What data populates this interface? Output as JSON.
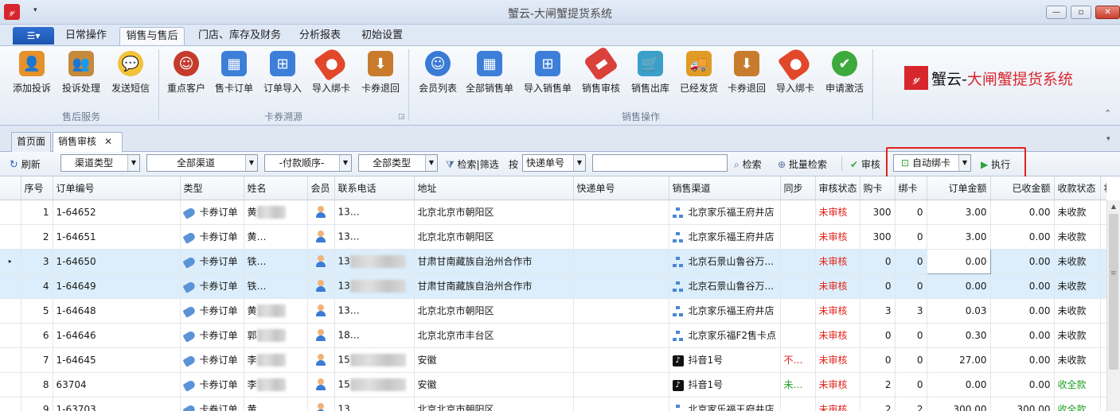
{
  "app": {
    "title": "蟹云-大闸蟹提货系统",
    "qa_arrow": "▾",
    "icon_text": "𝓎"
  },
  "window_controls": {
    "minimize": "—",
    "maximize": "▫",
    "close": "✕"
  },
  "menu": {
    "file_label": "☰▾",
    "tabs": [
      {
        "label": "日常操作",
        "active": false
      },
      {
        "label": "销售与售后",
        "active": true
      },
      {
        "label": "门店、库存及财务",
        "active": false
      },
      {
        "label": "分析报表",
        "active": false
      },
      {
        "label": "初始设置",
        "active": false
      }
    ]
  },
  "ribbon": {
    "groups": [
      {
        "label": "售后服务",
        "buttons": [
          {
            "label": "添加投诉",
            "icon": "add-complaint-icon",
            "color": "#e6912c"
          },
          {
            "label": "投诉处理",
            "icon": "handle-complaint-icon",
            "color": "#c58a3b"
          },
          {
            "label": "发送短信",
            "icon": "sms-bubble-icon",
            "color": "#f2c23a"
          }
        ]
      },
      {
        "label": "卡券溯源",
        "buttons": [
          {
            "label": "重点客户",
            "icon": "key-customer-icon",
            "color": "#c43b2c"
          },
          {
            "label": "售卡订单",
            "icon": "card-order-grid-icon",
            "color": "#3d7fd8"
          },
          {
            "label": "订单导入",
            "icon": "order-import-tree-icon",
            "color": "#3d7fd8"
          },
          {
            "label": "导入绑卡",
            "icon": "import-bind-tag-icon",
            "color": "#e2472a"
          },
          {
            "label": "卡券退回",
            "icon": "card-return-box-icon",
            "color": "#c97b2d"
          }
        ]
      },
      {
        "label": "销售操作",
        "buttons": [
          {
            "label": "会员列表",
            "icon": "member-list-icon",
            "color": "#3a7bd5"
          },
          {
            "label": "全部销售单",
            "icon": "all-sales-grid-icon",
            "color": "#3d7fd8"
          },
          {
            "label": "导入销售单",
            "icon": "import-sales-tree-icon",
            "color": "#3d7fd8"
          },
          {
            "label": "销售审核",
            "icon": "sales-audit-eraser-icon",
            "color": "#d9413a"
          },
          {
            "label": "销售出库",
            "icon": "sales-outbound-cart-icon",
            "color": "#3aa0c9"
          },
          {
            "label": "已经发货",
            "icon": "shipped-truck-icon",
            "color": "#e09a25"
          },
          {
            "label": "卡券退回",
            "icon": "card-return-box-icon",
            "color": "#c97b2d"
          },
          {
            "label": "导入绑卡",
            "icon": "import-bind-tag-icon",
            "color": "#e2472a"
          },
          {
            "label": "申请激活",
            "icon": "activate-check-icon",
            "color": "#3caa3c"
          }
        ]
      }
    ],
    "dialog_launcher": "◲",
    "collapse_icon": "⌃"
  },
  "brand": {
    "logo": "𝓎",
    "part1": "蟹云-",
    "part2": "大闸蟹提货系统"
  },
  "doc_tabs": [
    {
      "label": "首页面",
      "active": false
    },
    {
      "label": "销售审核",
      "active": true,
      "close": "✕"
    }
  ],
  "tabs_dropdown": "▾",
  "toolbar": {
    "refresh": "刷新",
    "channel_type": "渠道类型",
    "all_channels": "全部渠道",
    "payment_order": "-付款顺序-",
    "all_types": "全部类型",
    "search_filter": "检索|筛选",
    "by": "按",
    "express_no": "快递单号",
    "search_value": "",
    "search": "检索",
    "batch_search": "批量检索",
    "audit": "审核",
    "auto_bind": "自动绑卡",
    "execute": "执行",
    "combo_arrow": "▼"
  },
  "grid": {
    "columns": [
      "序号",
      "订单编号",
      "类型",
      "姓名",
      "会员",
      "联系电话",
      "地址",
      "快递单号",
      "销售渠道",
      "同步",
      "审核状态",
      "购卡",
      "绑卡",
      "订单金额",
      "已收金额",
      "收款状态",
      "状"
    ],
    "row_indicator": "▸",
    "rows": [
      {
        "seq": "1",
        "order": "1-64652",
        "type": "卡券订单",
        "name": "黄",
        "phone": "13",
        "address": "北京北京市朝阳区",
        "express": "",
        "channel": "北京家乐福王府井店",
        "channel_icon": "network",
        "sync": "",
        "sync_color": "",
        "audit": "未审核",
        "buy": "300",
        "bind": "0",
        "amount": "3.00",
        "received": "0.00",
        "pay_status": "未收款",
        "pay_color": "",
        "selected": false
      },
      {
        "seq": "2",
        "order": "1-64651",
        "type": "卡券订单",
        "name": "黄",
        "phone": "13",
        "address": "北京北京市朝阳区",
        "express": "",
        "channel": "北京家乐福王府井店",
        "channel_icon": "network",
        "sync": "",
        "sync_color": "",
        "audit": "未审核",
        "buy": "300",
        "bind": "0",
        "amount": "3.00",
        "received": "0.00",
        "pay_status": "未收款",
        "pay_color": "",
        "selected": false
      },
      {
        "seq": "3",
        "order": "1-64650",
        "type": "卡券订单",
        "name": "铁",
        "phone": "13",
        "address": "甘肃甘南藏族自治州合作市",
        "express": "",
        "channel": "北京石景山鲁谷万...",
        "channel_icon": "network",
        "sync": "",
        "sync_color": "",
        "audit": "未审核",
        "buy": "0",
        "bind": "0",
        "amount": "0.00",
        "received": "0.00",
        "pay_status": "未收款",
        "pay_color": "",
        "selected": true
      },
      {
        "seq": "4",
        "order": "1-64649",
        "type": "卡券订单",
        "name": "铁",
        "phone": "13",
        "address": "甘肃甘南藏族自治州合作市",
        "express": "",
        "channel": "北京石景山鲁谷万...",
        "channel_icon": "network",
        "sync": "",
        "sync_color": "",
        "audit": "未审核",
        "buy": "0",
        "bind": "0",
        "amount": "0.00",
        "received": "0.00",
        "pay_status": "未收款",
        "pay_color": "",
        "selected": true
      },
      {
        "seq": "5",
        "order": "1-64648",
        "type": "卡券订单",
        "name": "黄",
        "phone": "13",
        "address": "北京北京市朝阳区",
        "express": "",
        "channel": "北京家乐福王府井店",
        "channel_icon": "network",
        "sync": "",
        "sync_color": "",
        "audit": "未审核",
        "buy": "3",
        "bind": "3",
        "amount": "0.03",
        "received": "0.00",
        "pay_status": "未收款",
        "pay_color": "",
        "selected": false
      },
      {
        "seq": "6",
        "order": "1-64646",
        "type": "卡券订单",
        "name": "郭",
        "phone": "18",
        "address": "北京北京市丰台区",
        "express": "",
        "channel": "北京家乐福F2售卡点",
        "channel_icon": "network",
        "sync": "",
        "sync_color": "",
        "audit": "未审核",
        "buy": "0",
        "bind": "0",
        "amount": "0.30",
        "received": "0.00",
        "pay_status": "未收款",
        "pay_color": "",
        "selected": false
      },
      {
        "seq": "7",
        "order": "1-64645",
        "type": "卡券订单",
        "name": "李",
        "phone": "15",
        "address": "安徽",
        "express": "",
        "channel": "抖音1号",
        "channel_icon": "tiktok",
        "sync": "不推送",
        "sync_color": "red",
        "audit": "未审核",
        "buy": "0",
        "bind": "0",
        "amount": "27.00",
        "received": "0.00",
        "pay_status": "未收款",
        "pay_color": "",
        "selected": false
      },
      {
        "seq": "8",
        "order": "63704",
        "type": "卡券订单",
        "name": "李",
        "phone": "15",
        "address": "安徽",
        "express": "",
        "channel": "抖音1号",
        "channel_icon": "tiktok",
        "sync": "未绑好",
        "sync_color": "green",
        "audit": "未审核",
        "buy": "2",
        "bind": "0",
        "amount": "0.00",
        "received": "0.00",
        "pay_status": "收全款",
        "pay_color": "green",
        "selected": false
      },
      {
        "seq": "9",
        "order": "1-63703",
        "type": "卡券订单",
        "name": "黄",
        "phone": "13",
        "address": "北京北京市朝阳区",
        "express": "",
        "channel": "北京家乐福王府井店",
        "channel_icon": "network",
        "sync": "",
        "sync_color": "",
        "audit": "未审核",
        "buy": "2",
        "bind": "2",
        "amount": "300.00",
        "received": "300.00",
        "pay_status": "收全款",
        "pay_color": "green",
        "selected": false
      }
    ]
  },
  "scroll": {
    "up": "▲",
    "grip": "≡"
  }
}
